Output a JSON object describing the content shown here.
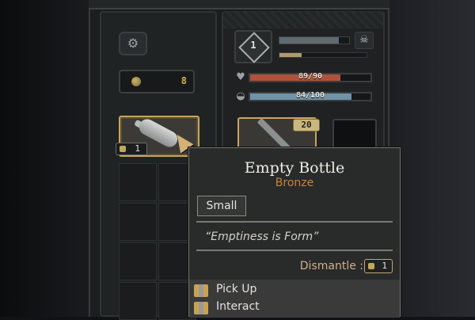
{
  "hud": {
    "gold": "8",
    "level": "1",
    "xp_fill": 0.85,
    "xp2_fill": 0.25,
    "health": {
      "text": "89/90",
      "fill": 0.75,
      "color": "#b0523a"
    },
    "stamina": {
      "text": "84/100",
      "fill": 0.84,
      "color": "#6f93a7"
    }
  },
  "inventory": {
    "selected_count": "1",
    "secondary_price": "20"
  },
  "tooltip": {
    "title": "Empty Bottle",
    "subtitle": "Bronze",
    "tag": "Small",
    "quote": "“Emptiness is Form”",
    "dismantle_label": "Dismantle :",
    "dismantle_value": "1",
    "actions": [
      "Pick Up",
      "Interact"
    ]
  },
  "icons": {
    "settings": "settings-icon",
    "skull": "skull-icon",
    "heart": "heart-icon",
    "stamina": "stamina-icon",
    "coin": "coin-icon",
    "bottle": "bottle-icon",
    "knife": "knife-icon",
    "cursor": "cursor-pointer-icon"
  }
}
